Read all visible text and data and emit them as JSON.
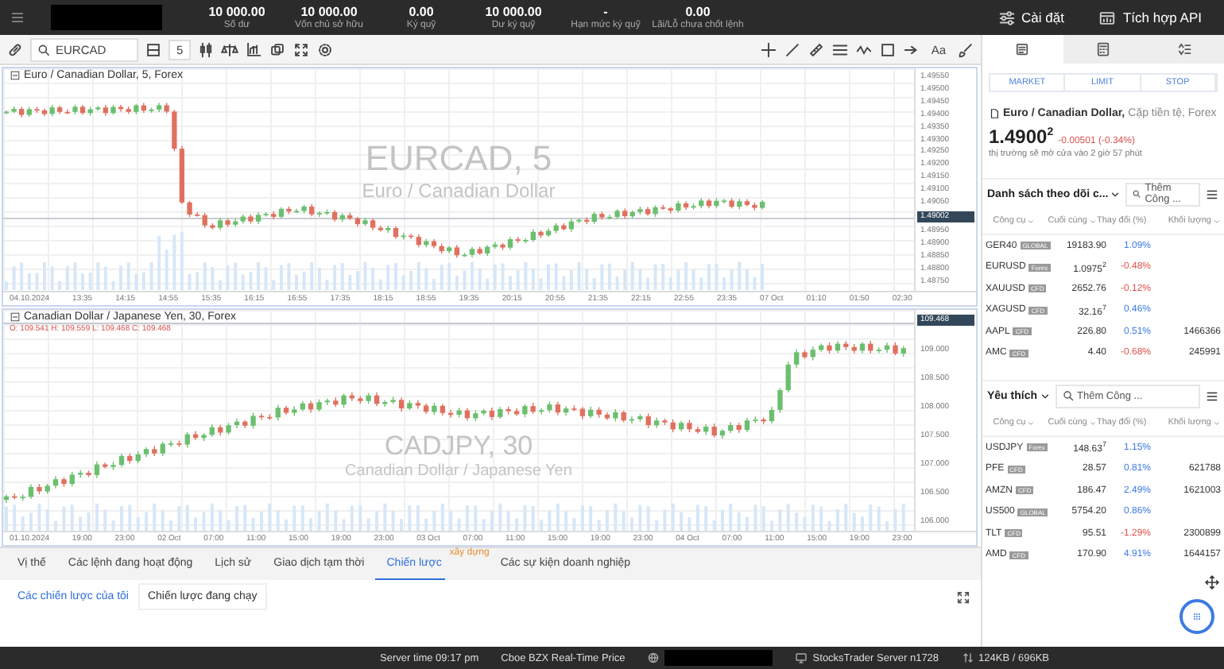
{
  "top_bar": {
    "stats": [
      {
        "value": "10 000.00",
        "label": "Số dư"
      },
      {
        "value": "10 000.00",
        "label": "Vốn chủ sở hữu"
      },
      {
        "value": "0.00",
        "label": "Ký quỹ"
      },
      {
        "value": "10 000.00",
        "label": "Dư ký quỹ"
      },
      {
        "value": "-",
        "label": "Hạn mức ký quỹ"
      },
      {
        "value": "0.00",
        "label": "Lãi/Lỗ chưa chốt lệnh"
      }
    ],
    "actions": [
      {
        "kind": "settings",
        "label": "Cài đặt"
      },
      {
        "kind": "api",
        "label": "Tích hợp API"
      }
    ]
  },
  "toolbar": {
    "symbol": "EURCAD",
    "interval": "5",
    "text_tool": "Aa"
  },
  "charts": [
    {
      "title": "Euro / Canadian Dollar, 5, Forex",
      "watermark": "EURCAD, 5",
      "watermark_sub": "Euro / Canadian Dollar",
      "y_labels": [
        {
          "kind": "tick",
          "text": "1.49550"
        },
        {
          "kind": "tick",
          "text": "1.49500"
        },
        {
          "kind": "tick",
          "text": "1.49450"
        },
        {
          "kind": "tick",
          "text": "1.49400"
        },
        {
          "kind": "tick",
          "text": "1.49350"
        },
        {
          "kind": "tick",
          "text": "1.49300"
        },
        {
          "kind": "tick",
          "text": "1.49250"
        },
        {
          "kind": "tick",
          "text": "1.49200"
        },
        {
          "kind": "tick",
          "text": "1.49150"
        },
        {
          "kind": "tick",
          "text": "1.49100"
        },
        {
          "kind": "tick",
          "text": "1.49050"
        },
        {
          "kind": "price",
          "text": "1.49002"
        },
        {
          "kind": "tick",
          "text": "1.48950"
        },
        {
          "kind": "tick",
          "text": "1.48900"
        },
        {
          "kind": "tick",
          "text": "1.48850"
        },
        {
          "kind": "tick",
          "text": "1.48800"
        },
        {
          "kind": "tick",
          "text": "1.48750"
        }
      ],
      "x_labels": [
        "04.10.2024",
        "13:35",
        "14:15",
        "14:55",
        "15:35",
        "16:15",
        "16:55",
        "17:35",
        "18:15",
        "18:55",
        "19:35",
        "20:15",
        "20:55",
        "21:35",
        "22:15",
        "22:55",
        "23:35",
        "07 Oct",
        "01:10",
        "01:50",
        "02:30"
      ]
    },
    {
      "title": "Canadian Dollar / Japanese Yen, 30, Forex",
      "ohlc": "O: 109.541 H: 109.559 L: 109.468 C: 109.468",
      "watermark": "CADJPY, 30",
      "watermark_sub": "Canadian Dollar / Japanese Yen",
      "y_labels": [
        {
          "kind": "price",
          "text": "109.468"
        },
        {
          "kind": "tick",
          "text": "109.000"
        },
        {
          "kind": "tick",
          "text": "108.500"
        },
        {
          "kind": "tick",
          "text": "108.000"
        },
        {
          "kind": "tick",
          "text": "107.500"
        },
        {
          "kind": "tick",
          "text": "107.000"
        },
        {
          "kind": "tick",
          "text": "106.500"
        },
        {
          "kind": "tick",
          "text": "106.000"
        }
      ],
      "x_labels": [
        "01.10.2024",
        "19:00",
        "23:00",
        "02 Oct",
        "07:00",
        "11:00",
        "15:00",
        "19:00",
        "23:00",
        "03 Oct",
        "07:00",
        "11:00",
        "15:00",
        "19:00",
        "23:00",
        "04 Oct",
        "07:00",
        "11:00",
        "15:00",
        "19:00",
        "23:00"
      ]
    }
  ],
  "bottom_panel": {
    "tabs": [
      {
        "label": "Vị thế",
        "selected": false
      },
      {
        "label": "Các lệnh đang hoạt động",
        "selected": false
      },
      {
        "label": "Lịch sử",
        "selected": false
      },
      {
        "label": "Giao dịch tạm thời",
        "selected": false
      },
      {
        "label": "Chiến lược",
        "selected": true,
        "badge": "xây dựng"
      },
      {
        "label": "Các sự kiện doanh nghiệp",
        "selected": false
      }
    ],
    "subtabs": [
      {
        "label": "Các chiến lược của tôi",
        "selected": true
      },
      {
        "label": "Chiến lược đang chạy",
        "selected": false
      }
    ]
  },
  "side_panel": {
    "tabs": [
      {
        "kind": "order",
        "selected": true
      },
      {
        "kind": "calculator",
        "selected": false
      },
      {
        "kind": "sort",
        "selected": false
      }
    ],
    "order_types": [
      "MARKET",
      "LIMIT",
      "STOP"
    ],
    "instrument": {
      "name": "Euro / Canadian Dollar,",
      "category": "Cặp tiền tệ, Forex",
      "price": "1.4900$^{2}$",
      "change": "-0.00501 (-0.34%)",
      "note": "thị trường sẽ mở cửa vào 2 giờ 57 phút"
    },
    "lists": [
      {
        "title": "Danh sách theo dõi c...",
        "search_placeholder": "Thêm Công ...",
        "columns": [
          "Công cụ",
          "Cuối cùng",
          "Thay đổi (%)",
          "Khối lượng"
        ],
        "rows": [
          {
            "symbol": "GER40",
            "tag": "GLOBAL",
            "last": "19183.90",
            "change": "1.09%",
            "color": "#3d7be3"
          },
          {
            "symbol": "EURUSD",
            "tag": "Forex",
            "last": "1.0975$^{2}$",
            "change": "-0.48%",
            "color": "#e0524a"
          },
          {
            "symbol": "XAUUSD",
            "tag": "CFD",
            "last": "2652.76",
            "change": "-0.12%",
            "color": "#e0524a"
          },
          {
            "symbol": "XAGUSD",
            "tag": "CFD",
            "last": "32.16$^{7}$",
            "change": "0.46%",
            "color": "#3d7be3"
          },
          {
            "symbol": "AAPL",
            "tag": "CFD",
            "last": "226.80",
            "change": "0.51%",
            "color": "#3d7be3",
            "volume": "1466366"
          },
          {
            "symbol": "AMC",
            "tag": "CFD",
            "last": "4.40",
            "change": "-0.68%",
            "color": "#e0524a",
            "volume": "245991"
          }
        ]
      },
      {
        "title": "Yêu thích",
        "search_placeholder": "Thêm Công ...",
        "columns": [
          "Công cụ",
          "Cuối cùng",
          "Thay đổi (%)",
          "Khối lượng"
        ],
        "rows": [
          {
            "symbol": "USDJPY",
            "tag": "Forex",
            "last": "148.63$^{7}$",
            "change": "1.15%",
            "color": "#3d7be3"
          },
          {
            "symbol": "PFE",
            "tag": "CFD",
            "last": "28.57",
            "change": "0.81%",
            "color": "#3d7be3",
            "volume": "621788"
          },
          {
            "symbol": "AMZN",
            "tag": "CFD",
            "last": "186.47",
            "change": "2.49%",
            "color": "#3d7be3",
            "volume": "1621003"
          },
          {
            "symbol": "US500",
            "tag": "GLOBAL",
            "last": "5754.20",
            "change": "0.86%",
            "color": "#3d7be3"
          },
          {
            "symbol": "TLT",
            "tag": "CFD",
            "last": "95.51",
            "change": "-1.29%",
            "color": "#e0524a",
            "volume": "2300899"
          },
          {
            "symbol": "AMD",
            "tag": "CFD",
            "last": "170.90",
            "change": "4.91%",
            "color": "#3d7be3",
            "volume": "1644157"
          }
        ]
      }
    ]
  },
  "status_bar": {
    "items": [
      {
        "kind": "text",
        "text": "Server time 09:17 pm"
      },
      {
        "kind": "text",
        "text": "Cboe BZX Real-Time Price"
      },
      {
        "kind": "hidden"
      },
      {
        "kind": "server",
        "text": "StocksTrader Server n1728"
      },
      {
        "kind": "traffic",
        "text": "124KB / 696KB"
      }
    ]
  }
}
